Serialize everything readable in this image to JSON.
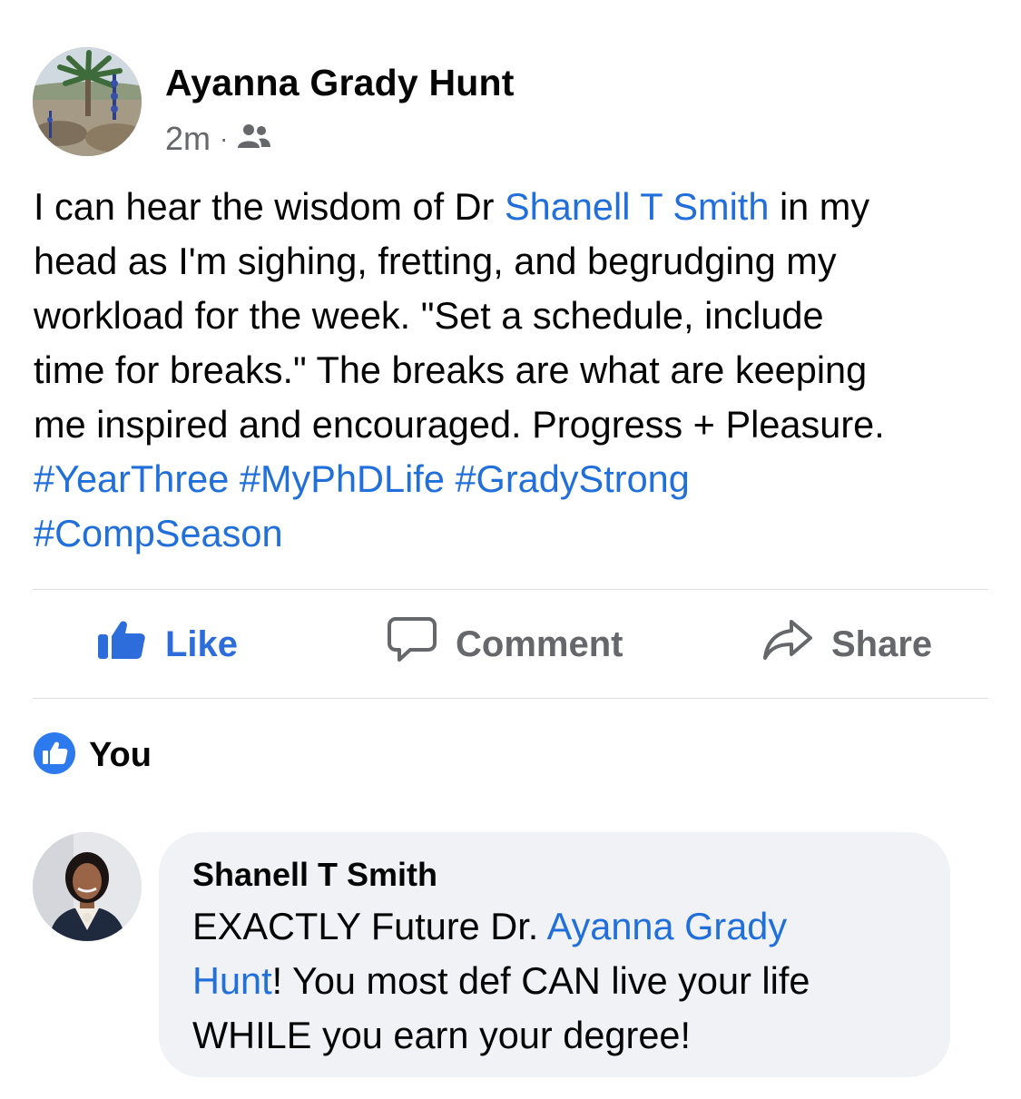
{
  "post": {
    "author": "Ayanna Grady Hunt",
    "time": "2m",
    "separator": "·",
    "audience_icon": "friends-icon",
    "body_lines": [
      [
        {
          "text": "I can hear the wisdom of Dr "
        },
        {
          "text": "Shanell T Smith",
          "link": true
        },
        {
          "text": " in my"
        }
      ],
      [
        {
          "text": "head as I'm sighing,  fretting, and begrudging my"
        }
      ],
      [
        {
          "text": "workload for the week.  \"Set a schedule,  include"
        }
      ],
      [
        {
          "text": "time for breaks.\" The breaks are what are keeping"
        }
      ],
      [
        {
          "text": "me inspired and encouraged.  Progress + Pleasure."
        }
      ],
      [
        {
          "text": "#YearThree",
          "link": true
        },
        {
          "text": " "
        },
        {
          "text": "#MyPhDLife",
          "link": true
        },
        {
          "text": " "
        },
        {
          "text": "#GradyStrong",
          "link": true
        }
      ],
      [
        {
          "text": "#CompSeason",
          "link": true
        }
      ]
    ]
  },
  "actions": {
    "like_label": "Like",
    "comment_label": "Comment",
    "share_label": "Share"
  },
  "reactions": {
    "icon": "like-badge-icon",
    "names": "You"
  },
  "comment": {
    "author": "Shanell T Smith",
    "lines": [
      [
        {
          "text": "EXACTLY Future Dr. "
        },
        {
          "text": "Ayanna Grady",
          "link": true
        }
      ],
      [
        {
          "text": "Hunt",
          "link": true
        },
        {
          "text": "! You most def CAN live your life"
        }
      ],
      [
        {
          "text": "WHILE you earn your degree!"
        }
      ]
    ]
  },
  "colors": {
    "link": "#216fdb",
    "like_active": "#2d6ddb",
    "muted": "#65676b",
    "bubble": "#f0f2f5"
  }
}
